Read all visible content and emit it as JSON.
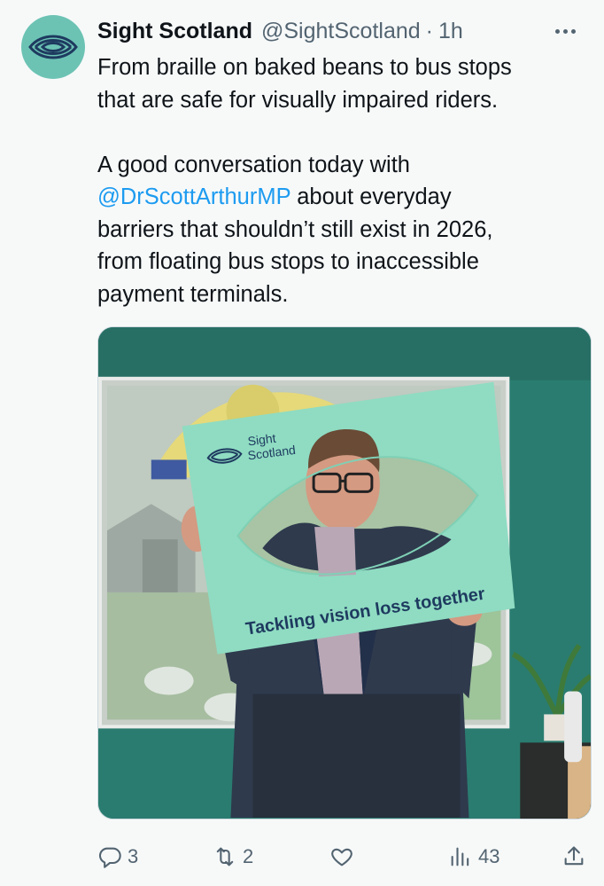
{
  "author": {
    "display_name": "Sight Scotland",
    "handle": "@SightScotland",
    "separator": "·",
    "timestamp": "1h",
    "avatar_color": "#6cc3b4"
  },
  "tweet": {
    "line1": "From braille on baked beans to bus stops",
    "line2": "that are safe for visually impaired riders.",
    "line3": "A good conversation today with",
    "mention": "@DrScottArthurMP",
    "line4_rest": " about everyday",
    "line5": "barriers that shouldn’t still exist in 2026,",
    "line6": "from floating bus stops to inaccessible",
    "line7": "payment terminals."
  },
  "media": {
    "frame_logo_line1": "Sight",
    "frame_logo_line2": "Scotland",
    "frame_tagline": "Tackling vision loss together"
  },
  "actions": {
    "reply_icon": "reply-icon",
    "reply_count": "3",
    "retweet_icon": "retweet-icon",
    "retweet_count": "2",
    "like_icon": "heart-icon",
    "views_icon": "views-chart-icon",
    "views_count": "43",
    "share_icon": "share-icon"
  },
  "colors": {
    "link": "#1d9bf0",
    "muted": "#536471",
    "frame": "#8fdcc2",
    "wall": "#2c7f73"
  }
}
